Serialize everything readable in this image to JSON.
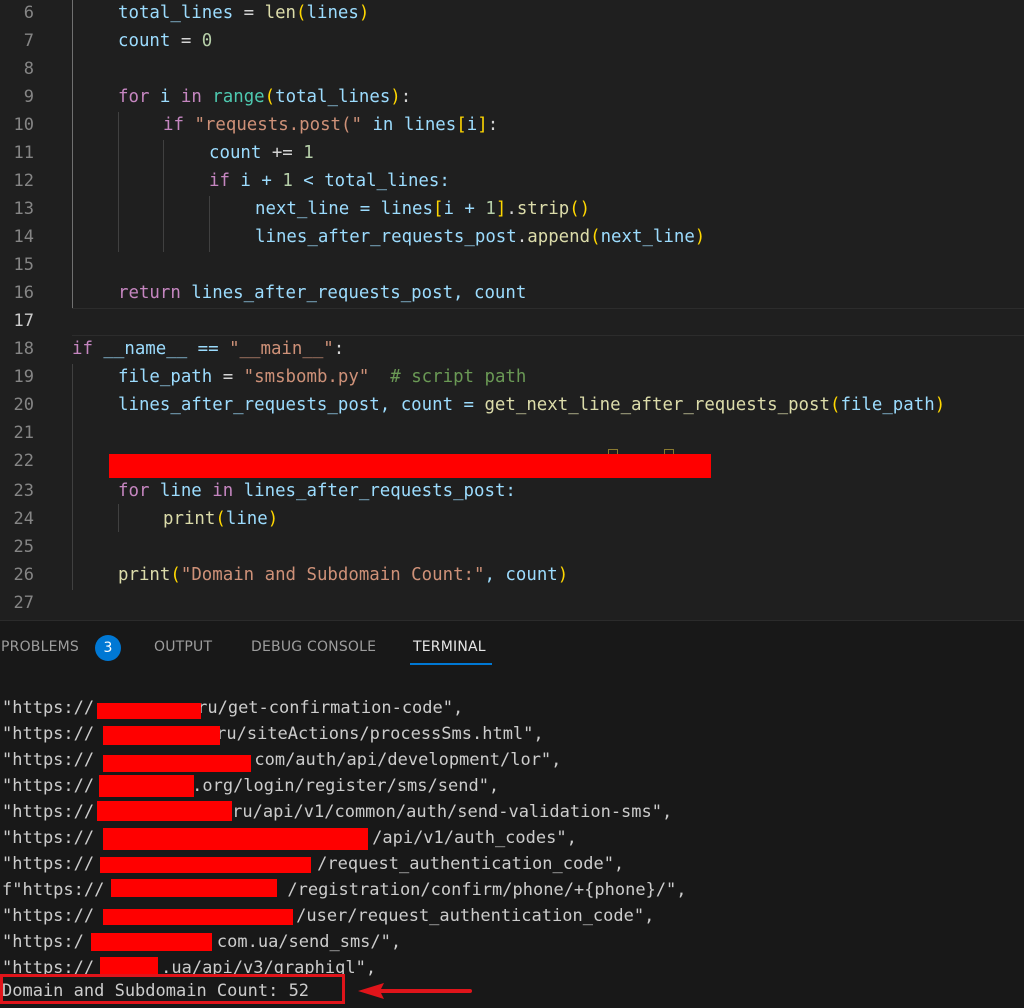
{
  "editor": {
    "lines": [
      {
        "n": "6",
        "text": "total_lines = len(lines)"
      },
      {
        "n": "7",
        "text": "count = 0"
      },
      {
        "n": "8",
        "text": ""
      },
      {
        "n": "9",
        "text": "for i in range(total_lines):"
      },
      {
        "n": "10",
        "text": "if \"requests.post(\" in lines[i]:"
      },
      {
        "n": "11",
        "text": "count += 1"
      },
      {
        "n": "12",
        "text": "if i + 1 < total_lines:"
      },
      {
        "n": "13",
        "text": "next_line = lines[i + 1].strip()"
      },
      {
        "n": "14",
        "text": "lines_after_requests_post.append(next_line)"
      },
      {
        "n": "15",
        "text": ""
      },
      {
        "n": "16",
        "text": "return lines_after_requests_post, count"
      },
      {
        "n": "17",
        "text": ""
      },
      {
        "n": "18",
        "text": "if __name__ == \"__main__\":"
      },
      {
        "n": "19",
        "text": "file_path = \"smsbomb.py\"  # script path"
      },
      {
        "n": "20",
        "text": "lines_after_requests_post, count = get_next_line_after_requests_post(file_path)"
      },
      {
        "n": "21",
        "text": ""
      },
      {
        "n": "22",
        "text": "[redacted]"
      },
      {
        "n": "23",
        "text": "for line in lines_after_requests_post:"
      },
      {
        "n": "24",
        "text": "print(line)"
      },
      {
        "n": "25",
        "text": ""
      },
      {
        "n": "26",
        "text": "print(\"Domain and Subdomain Count:\", count)"
      },
      {
        "n": "27",
        "text": ""
      }
    ],
    "active_line": "17",
    "tokens": {
      "l6": [
        "total_lines",
        " = ",
        "len",
        "(",
        "lines",
        ")"
      ],
      "l7": [
        "count",
        " = ",
        "0"
      ],
      "l9": [
        "for",
        " i ",
        "in",
        " ",
        "range",
        "(",
        "total_lines",
        ")",
        ":"
      ],
      "l10": [
        "if",
        " ",
        "\"requests.post(\"",
        " ",
        "in",
        " lines",
        "[",
        "i",
        "]",
        ":"
      ],
      "l11": [
        "count",
        " += ",
        "1"
      ],
      "l12": [
        "if",
        " i + ",
        "1",
        " < total_lines:"
      ],
      "l13": [
        "next_line",
        " = lines",
        "[",
        "i + ",
        "1",
        "]",
        ".",
        "strip",
        "(",
        ")"
      ],
      "l14": [
        "lines_after_requests_post",
        ".",
        "append",
        "(",
        "next_line",
        ")"
      ],
      "l16": [
        "return",
        " lines_after_requests_post, count"
      ],
      "l18": [
        "if",
        " __name__ == ",
        "\"__main__\"",
        ":"
      ],
      "l19": [
        "file_path",
        " = ",
        "\"smsbomb.py\"",
        "  ",
        "# script path"
      ],
      "l20": [
        "lines_after_requests_post, count = ",
        "get_next_line_after_requests_post",
        "(",
        "file_path",
        ")"
      ],
      "l23": [
        "for",
        " line ",
        "in",
        " lines_after_requests_post:"
      ],
      "l24": [
        "print",
        "(",
        "line",
        ")"
      ],
      "l26": [
        "print",
        "(",
        "\"Domain and Subdomain Count:\"",
        ", count",
        ")"
      ]
    }
  },
  "panel": {
    "tabs": [
      {
        "label": "PROBLEMS",
        "badge": "3",
        "active": false
      },
      {
        "label": "OUTPUT",
        "active": false
      },
      {
        "label": "DEBUG CONSOLE",
        "active": false
      },
      {
        "label": "TERMINAL",
        "active": true
      }
    ],
    "terminal": {
      "lines": [
        {
          "prefix": "\"https://",
          "suffix": "ru/get-confirmation-code\","
        },
        {
          "prefix": "\"https://",
          "suffix": "ru/siteActions/processSms.html\","
        },
        {
          "prefix": "\"https://",
          "suffix": ".com/auth/api/development/lor\","
        },
        {
          "prefix": "\"https://",
          "suffix": ".org/login/register/sms/send\","
        },
        {
          "prefix": "\"https://",
          "suffix": "ru/api/v1/common/auth/send-validation-sms\","
        },
        {
          "prefix": "\"https://",
          "suffix": "/api/v1/auth_codes\","
        },
        {
          "prefix": "\"https://",
          "suffix": "/request_authentication_code\","
        },
        {
          "prefix": "f\"https://",
          "suffix": "/registration/confirm/phone/+{phone}/\","
        },
        {
          "prefix": "\"https://",
          "suffix": "/user/request_authentication_code\","
        },
        {
          "prefix": "\"https:/",
          "suffix": "com.ua/send_sms/\","
        },
        {
          "prefix": "\"https://",
          "suffix": ".ua/api/v3/graphiql\","
        }
      ],
      "result": "Domain and Subdomain Count: 52"
    }
  },
  "colors": {
    "redaction": "#ff0000",
    "highlight_box": "#e0141a",
    "accent": "#0078d4"
  }
}
